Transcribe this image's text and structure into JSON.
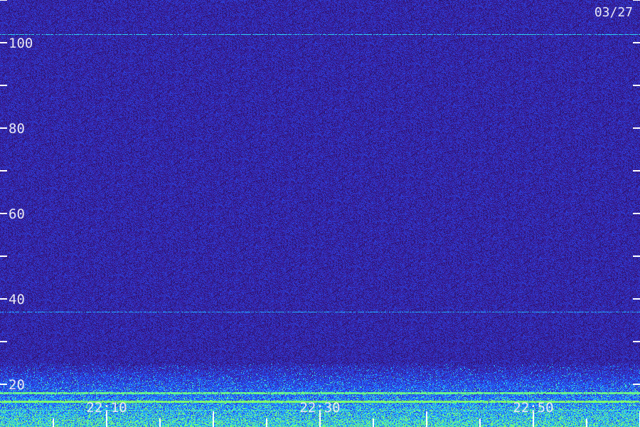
{
  "date_label": "03/27",
  "chart_data": {
    "type": "heatmap",
    "title": "",
    "xlabel": "",
    "ylabel": "",
    "x_ticks": [
      "22:10",
      "22:30",
      "22:50"
    ],
    "y_ticks": [
      20,
      40,
      60,
      80,
      100
    ],
    "ylim": [
      10,
      110
    ],
    "color_scale": [
      "#1a0a3c",
      "#3a1fa0",
      "#2255ff",
      "#22c8ff",
      "#7dff6a"
    ],
    "background_color": "#24105a",
    "narrowband_lines": [
      {
        "y": 102,
        "intensity": 0.6
      },
      {
        "y": 37,
        "intensity": 0.45
      },
      {
        "y": 18,
        "intensity": 0.9
      },
      {
        "y": 16,
        "intensity": 1.0
      },
      {
        "y": 14,
        "intensity": 0.7
      }
    ],
    "high_noise_below": 25
  }
}
